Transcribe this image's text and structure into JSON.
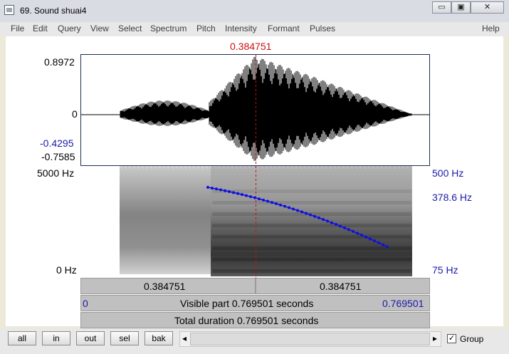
{
  "window": {
    "title": "69. Sound shuai4",
    "minimize": "▭",
    "maximize": "▣",
    "close": "✕"
  },
  "menu": [
    "File",
    "Edit",
    "Query",
    "View",
    "Select",
    "Spectrum",
    "Pitch",
    "Intensity",
    "Formant",
    "Pulses",
    "Help"
  ],
  "cursor_time": "0.384751",
  "waveform": {
    "max": "0.8972",
    "zero": "0",
    "sel_val": "-0.4295",
    "min": "-0.7585"
  },
  "spectrogram": {
    "freq_top": "5000 Hz",
    "freq_bottom": "0 Hz",
    "pitch_top": "500 Hz",
    "pitch_current": "378.6 Hz",
    "pitch_bottom": "75 Hz"
  },
  "bars": {
    "left_time": "0.384751",
    "right_time": "0.384751",
    "visible_start": "0",
    "visible_label": "Visible part 0.769501 seconds",
    "visible_end": "0.769501",
    "total_label": "Total duration 0.769501 seconds"
  },
  "buttons": {
    "all": "all",
    "in": "in",
    "out": "out",
    "sel": "sel",
    "bak": "bak"
  },
  "scroll": {
    "left_arrow": "◂",
    "right_arrow": "▸"
  },
  "group": {
    "label": "Group",
    "checked": "✓"
  },
  "colors": {
    "pitch": "#1010e0",
    "cursor": "#cc1010",
    "axis_blue": "#1a1aa8"
  }
}
